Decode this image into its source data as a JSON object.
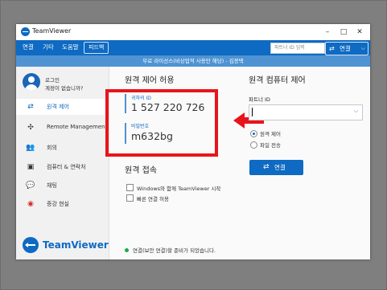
{
  "window": {
    "app_title": "TeamViewer",
    "controls": {
      "minimize": "–",
      "maximize": "□",
      "close": "✕"
    }
  },
  "menu": {
    "items": [
      "연결",
      "기타",
      "도움말"
    ],
    "badge": "피드백",
    "partner_id_placeholder": "파트너 ID 입력",
    "connect_label": "연결"
  },
  "notice": "무료 라이선스(비상업적 사용만 해당) - 김봉택",
  "sidebar": {
    "login_line1": "로그인",
    "login_line2": "계정이 없습니까?",
    "items": [
      {
        "label": "원격 제어",
        "icon": "arrows-icon",
        "active": true
      },
      {
        "label": "Remote Management",
        "icon": "remote-management-icon",
        "active": false
      },
      {
        "label": "회의",
        "icon": "meeting-icon",
        "active": false
      },
      {
        "label": "컴퓨터 & 연락처",
        "icon": "contacts-icon",
        "active": false
      },
      {
        "label": "채팅",
        "icon": "chat-icon",
        "active": false
      },
      {
        "label": "증강 현실",
        "icon": "augmented-reality-icon",
        "active": false
      }
    ],
    "brand": "TeamViewer"
  },
  "remote_control": {
    "title": "원격 제어 허용",
    "your_id_label": "귀하의 ID",
    "your_id_value": "1 527 220 726",
    "password_label": "비밀번호",
    "password_value": "m632bg"
  },
  "unattended": {
    "title": "원격 접속",
    "option1": "Windows와 함께 TeamViewer 시작",
    "option2": "빠른 연결 허용"
  },
  "control_remote": {
    "title": "원격 컴퓨터 제어",
    "partner_id_label": "파트너 ID",
    "partner_id_value": "",
    "radio1": "원격 제어",
    "radio2": "파일 전송",
    "connect_label": "연결"
  },
  "status": "연결(보안 연결)할 준비가 되었습니다.",
  "colors": {
    "brand_blue": "#0e6ac2",
    "notice_blue": "#4f93d3",
    "highlight_red": "#e8141c",
    "status_green": "#1ba94b"
  }
}
